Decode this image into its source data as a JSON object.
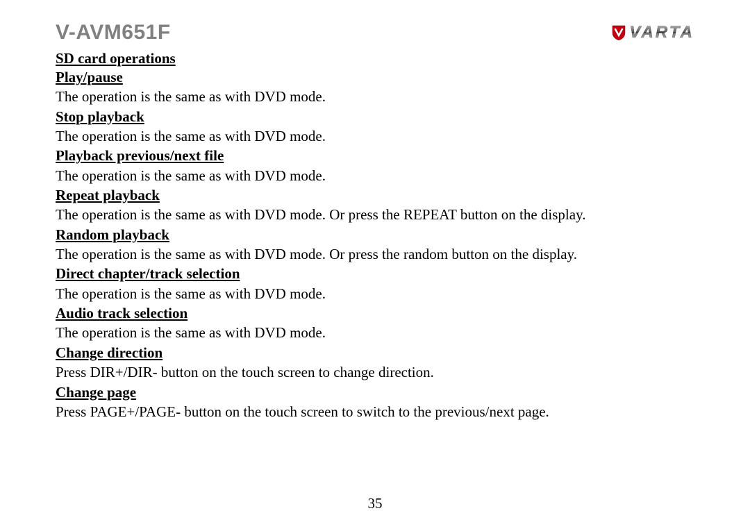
{
  "header": {
    "model": "V-AVM651F",
    "brand": "VARTA"
  },
  "section_title": "SD card operations",
  "sections": [
    {
      "heading": "Play/pause",
      "body": "The operation is the same as with DVD mode."
    },
    {
      "heading": "Stop playback",
      "body": "The operation is the same as with DVD mode."
    },
    {
      "heading": "Playback previous/next file",
      "body": "The operation is the same as with DVD mode."
    },
    {
      "heading": "Repeat playback",
      "body": "The operation is the same as with DVD mode. Or press the REPEAT button on the display."
    },
    {
      "heading": "Random playback",
      "body": "The operation is the same as with DVD mode. Or press the random button on the display."
    },
    {
      "heading": "Direct chapter/track selection",
      "body": "The operation is the same as with DVD mode."
    },
    {
      "heading": "Audio track selection",
      "body": "The operation is the same as with DVD mode."
    },
    {
      "heading": "Change direction",
      "body": "Press DIR+/DIR- button on the touch screen to change direction."
    },
    {
      "heading": "Change page",
      "body": "Press PAGE+/PAGE- button on the touch screen to switch to the previous/next page."
    }
  ],
  "page_number": "35"
}
